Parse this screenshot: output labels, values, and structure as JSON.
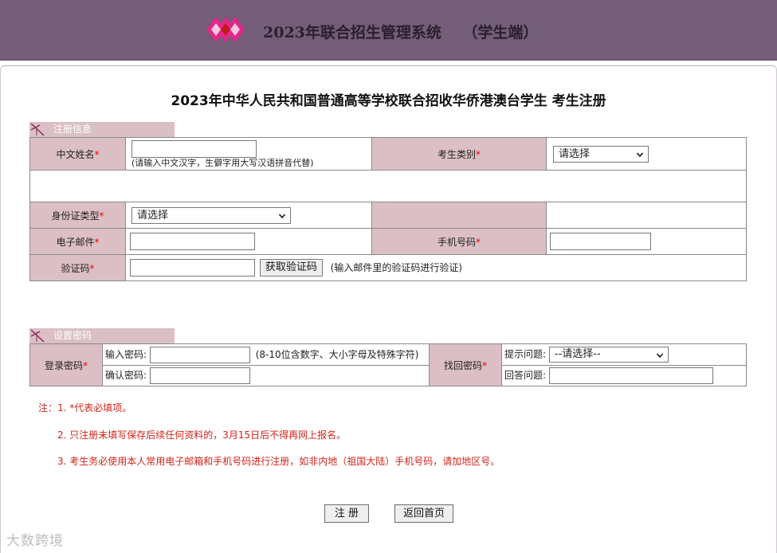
{
  "header": {
    "title": "2023年联合招生管理系统    （学生端）"
  },
  "main_title": "2023年中华人民共和国普通高等学校联合招收华侨港澳台学生  考生注册",
  "section_register": {
    "tab_label": "注册信息",
    "chinese_name_label": "中文姓名",
    "chinese_name_value": "",
    "chinese_name_hint": "(请输入中文汉字，生僻字用大写汉语拼音代替)",
    "candidate_type_label": "考生类别",
    "candidate_type_selected": "请选择",
    "id_type_label": "身份证类型",
    "id_type_selected": "请选择",
    "email_label": "电子邮件",
    "email_value": "",
    "phone_label": "手机号码",
    "phone_value": "",
    "code_label": "验证码",
    "code_value": "",
    "get_code_button": "获取验证码",
    "code_hint": "(输入邮件里的验证码进行验证)"
  },
  "section_password": {
    "tab_label": "设置密码",
    "login_password_label": "登录密码",
    "enter_password_label": "输入密码:",
    "enter_password_value": "",
    "password_hint": "(8-10位含数字、大小字母及特殊字符)",
    "confirm_password_label": "确认密码:",
    "confirm_password_value": "",
    "recover_password_label": "找回密码",
    "question_label": "提示问题:",
    "question_selected": "--请选择--",
    "answer_label": "回答问题:",
    "answer_value": ""
  },
  "required_mark": "*",
  "notes": {
    "note1": "注：1. *代表必填项。",
    "note2": "2. 只注册未填写保存后续任何资料的，3月15日后不得再网上报名。",
    "note3": "3. 考生务必使用本人常用电子邮箱和手机号码进行注册，如非内地（祖国大陆）手机号码，请加地区号。"
  },
  "buttons": {
    "register": "注 册",
    "back_home": "返回首页"
  },
  "watermark": "大数跨境",
  "colors": {
    "header_bg": "#735d78",
    "label_bg": "#dbbfc4",
    "required": "#e00000",
    "notes": "#d2231a"
  },
  "icons": {
    "logo": "magenta-diamond-logo-icon",
    "section": "section-flag-icon",
    "select_arrow": "chevron-down-icon"
  }
}
